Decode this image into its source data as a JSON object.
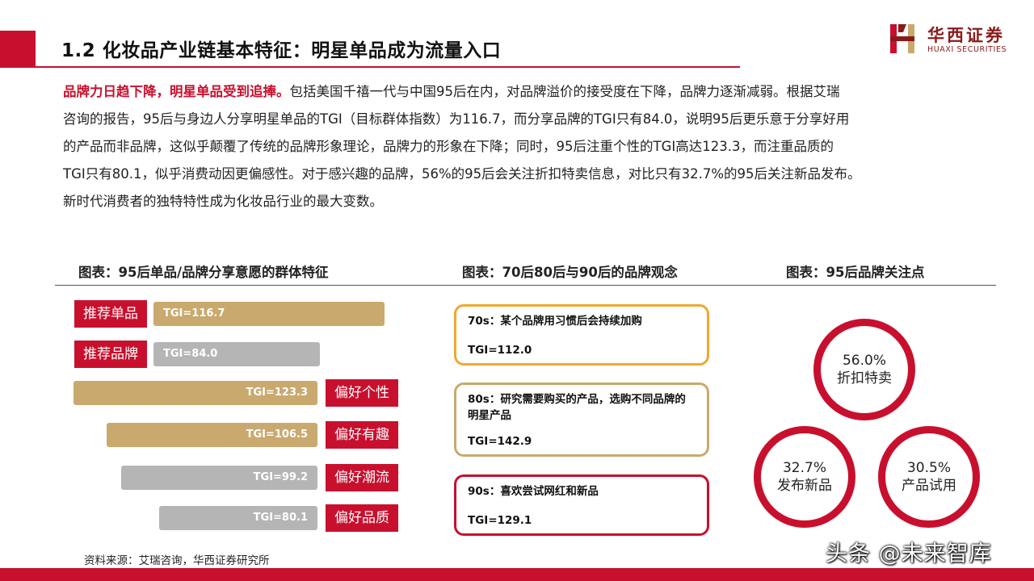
{
  "header": {
    "title": "1.2 化妆品产业链基本特征：明星单品成为流量入口",
    "logo_cn": "华西证券",
    "logo_en": "HUAXI SECURITIES"
  },
  "intro": {
    "lead": "品牌力日趋下降，明星单品受到追捧。",
    "line1_rest": "包括美国千禧一代与中国95后在内，对品牌溢价的接受度在下降，品牌力逐渐减弱。根据艾瑞",
    "line2": "咨询的报告，95后与身边人分享明星单品的TGI（目标群体指数）为116.7，而分享品牌的TGI只有84.0，说明95后更乐意于分享好用",
    "line3": "的产品而非品牌，这似乎颠覆了传统的品牌形象理论，品牌力的形象在下降；同时，95后注重个性的TGI高达123.3，而注重品质的",
    "line4": "TGI只有80.1，似乎消费动因更偏感性。对于感兴趣的品牌，56%的95后会关注折扣特卖信息，对比只有32.7%的95后关注新品发布。",
    "line5": "新时代消费者的独特特性成为化妆品行业的最大变数。"
  },
  "chart_titles": {
    "left": "图表：95后单品/品牌分享意愿的群体特征",
    "middle": "图表：70后80后与90后的品牌观念",
    "right": "图表：95后品牌关注点"
  },
  "chart_data": {
    "type": "bar",
    "categories": [
      "推荐单品",
      "推荐品牌",
      "偏好个性",
      "偏好有趣",
      "偏好潮流",
      "偏好品质"
    ],
    "series": [
      {
        "values": [
          116.7,
          84.0,
          123.3,
          106.5,
          99.2,
          80.1
        ]
      }
    ],
    "value_labels": [
      "TGI=116.7",
      "TGI=84.0",
      "TGI=123.3",
      "TGI=106.5",
      "TGI=99.2",
      "TGI=80.1"
    ],
    "colors": [
      "#c9a96e",
      "#b5b5b5",
      "#c9a96e",
      "#c9a96e",
      "#b5b5b5",
      "#b5b5b5"
    ],
    "label_color": "#c8102e"
  },
  "generations": [
    {
      "title": "70s：某个品牌用习惯后会持续加购",
      "tgi": "TGI=112.0",
      "border": "#f0a830"
    },
    {
      "title": "80s：研究需要购买的产品，选购不同品牌的明星产品",
      "tgi": "TGI=142.9",
      "border": "#c9a96e"
    },
    {
      "title": "90s：喜欢尝试网红和新品",
      "tgi": "TGI=129.1",
      "border": "#c8102e"
    }
  ],
  "focus_points": [
    {
      "pct": "56.0%",
      "label": "折扣特卖"
    },
    {
      "pct": "32.7%",
      "label": "发布新品"
    },
    {
      "pct": "30.5%",
      "label": "产品试用"
    }
  ],
  "footer": {
    "source": "资料来源：艾瑞咨询，华西证券研究所",
    "watermark": "头条 @未来智库"
  }
}
